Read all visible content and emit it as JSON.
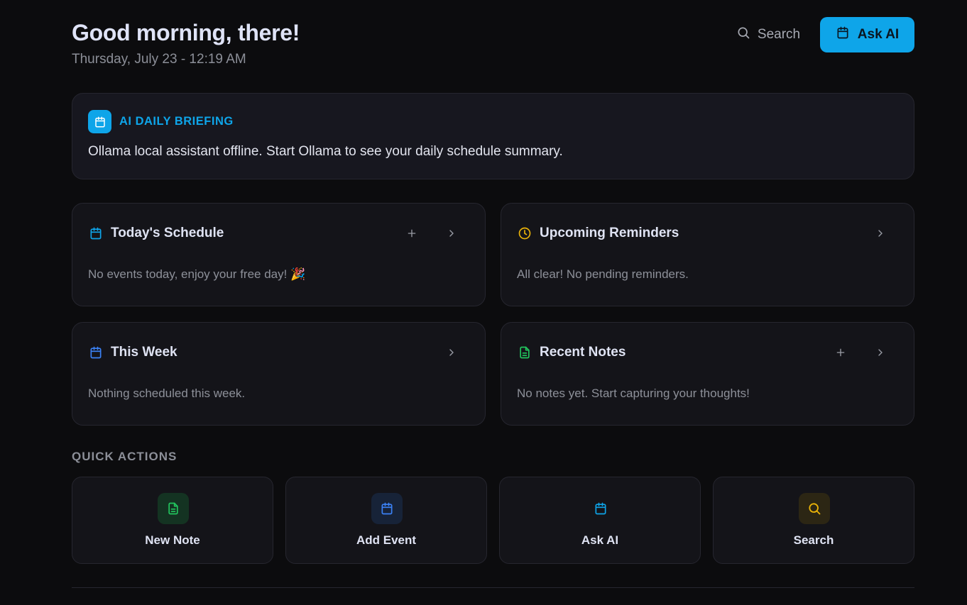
{
  "header": {
    "greeting": "Good morning, there!",
    "date": "Thursday, July 23 - 12:19 AM",
    "search_label": "Search",
    "ask_label": "Ask AI"
  },
  "briefing": {
    "title": "AI DAILY BRIEFING",
    "text": "Ollama local assistant offline. Start Ollama to see your daily schedule summary."
  },
  "cards": {
    "schedule": {
      "title": "Today's Schedule",
      "text": "No events today, enjoy your free day! 🎉"
    },
    "reminders": {
      "title": "Upcoming Reminders",
      "text": "All clear! No pending reminders."
    },
    "week": {
      "title": "This Week",
      "text": "Nothing scheduled this week."
    },
    "notes": {
      "title": "Recent Notes",
      "text": "No notes yet. Start capturing your thoughts!"
    }
  },
  "quick_actions": {
    "label": "QUICK ACTIONS",
    "items": [
      {
        "label": "New Note",
        "icon": "note-icon",
        "color": "#22c55e"
      },
      {
        "label": "Add Event",
        "icon": "calendar-icon",
        "color": "#3b82f6"
      },
      {
        "label": "Ask AI",
        "icon": "calendar-icon",
        "color": "#0ea5e9"
      },
      {
        "label": "Search",
        "icon": "search-icon",
        "color": "#eab308"
      }
    ]
  },
  "colors": {
    "accent": "#0ea5e9",
    "reminder": "#eab308",
    "notes": "#22c55e",
    "calendar": "#0ea5e9"
  }
}
